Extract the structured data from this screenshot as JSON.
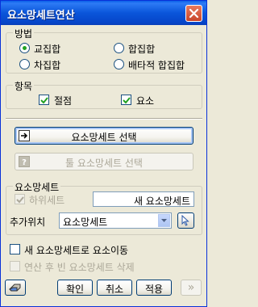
{
  "window": {
    "title": "요소망세트연산"
  },
  "method": {
    "label": "방법",
    "options": [
      {
        "label": "교집합",
        "selected": true
      },
      {
        "label": "합집합",
        "selected": false
      },
      {
        "label": "차집합",
        "selected": false
      },
      {
        "label": "배타적 합집합",
        "selected": false
      }
    ]
  },
  "items": {
    "label": "항목",
    "node_label": "절점",
    "node_checked": true,
    "element_label": "요소",
    "element_checked": true
  },
  "buttons": {
    "select_set": "요소망세트 선택",
    "select_tool_set": "툴 요소망세트 선택"
  },
  "element_set": {
    "label": "요소망세트",
    "subset_label": "하위세트",
    "name_value": "새 요소망세트",
    "add_position_label": "추가위치",
    "add_position_value": "요소망세트"
  },
  "options": {
    "move_label": "새 요소망세트로 요소이동",
    "delete_label": "연산 후 빈 요소망세트 삭제"
  },
  "footer": {
    "confirm": "확인",
    "cancel": "취소",
    "apply": "적용",
    "more": "»"
  }
}
